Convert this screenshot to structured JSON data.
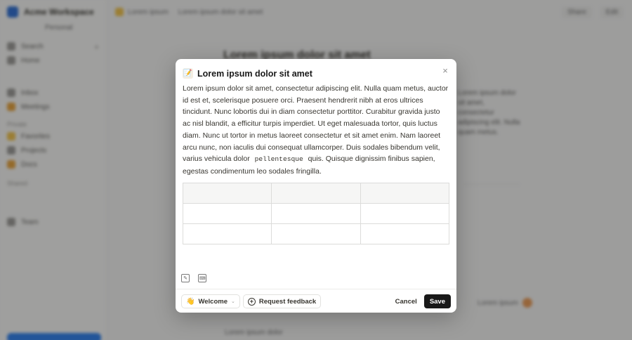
{
  "background": {
    "workspace_name": "Acme Workspace",
    "workspace_sub": "Personal",
    "sidebar_items": [
      "Search",
      "Home",
      "Inbox",
      "Meetings",
      "Favorites",
      "Projects",
      "Docs",
      "Team"
    ],
    "sidebar_heads": [
      "Private",
      "Shared"
    ],
    "breadcrumb": "Lorem ipsum",
    "breadcrumb_page": "Lorem ipsum dolor sit amet",
    "top_actions": [
      "Share",
      "Edit"
    ],
    "page_heading": "Lorem ipsum dolor sit amet",
    "side_note": "Lorem ipsum dolor sit amet, consectetur adipiscing elit. Nulla quam metus.",
    "bottom_line": "Lorem ipsum dolor",
    "pill": "Lorem ipsum"
  },
  "modal": {
    "title_icon": "memo-icon",
    "title": "Lorem ipsum dolor sit amet",
    "close_glyph": "×",
    "body_before_code": "Lorem ipsum dolor sit amet, consectetur adipiscing elit. Nulla quam metus, auctor id est et, scelerisque posuere orci. Praesent hendrerit nibh at eros ultrices tincidunt. Nunc lobortis dui in diam consectetur porttitor. Curabitur gravida justo ac nisl blandit, a efficitur turpis imperdiet. Ut eget malesuada tortor, quis luctus diam. Nunc ut tortor in metus laoreet consectetur et sit amet enim. Nam laoreet arcu nunc, non iaculis dui consequat ullamcorper. Duis sodales bibendum velit, varius vehicula dolor",
    "code_text": "pellentesque",
    "body_after_code": "quis. Quisque dignissim finibus sapien, egestas condimentum leo sodales fringilla.",
    "table": {
      "rows": [
        [
          "",
          "",
          ""
        ],
        [
          "",
          "",
          ""
        ],
        [
          "",
          "",
          ""
        ]
      ]
    },
    "tools": [
      {
        "name": "edit-square-icon",
        "glyph": "✎"
      },
      {
        "name": "keyboard-icon",
        "glyph": "⌨"
      }
    ],
    "footer": {
      "template_emoji": "👋",
      "template_label": "Welcome",
      "template_caret": "⌄",
      "feedback_label": "Request feedback",
      "cancel_label": "Cancel",
      "save_label": "Save"
    }
  },
  "colors": {
    "save_bg": "#191919",
    "overlay": "rgba(15,15,15,0.38)",
    "accent_blue": "#2f80ed",
    "accent_orange": "#e6a23c"
  }
}
